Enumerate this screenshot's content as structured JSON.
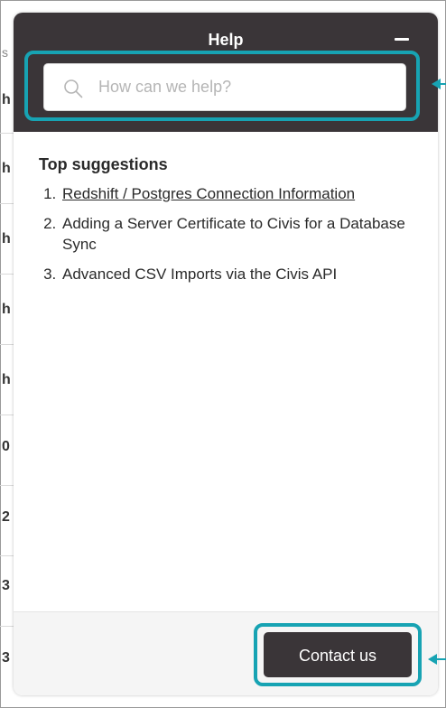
{
  "background": {
    "header_letter": "s",
    "row_letters": [
      "h",
      "h",
      "h",
      "h",
      "h",
      "0",
      "2",
      "3",
      "3"
    ]
  },
  "widget": {
    "title": "Help",
    "search": {
      "placeholder": "How can we help?",
      "value": ""
    },
    "suggestions_title": "Top suggestions",
    "suggestions": [
      {
        "label": "Redshift / Postgres Connection Information",
        "link": true
      },
      {
        "label": "Adding a Server Certificate to Civis for a Database Sync",
        "link": false
      },
      {
        "label": "Advanced CSV Imports via the Civis API",
        "link": false
      }
    ],
    "contact_label": "Contact us"
  },
  "colors": {
    "header_bg": "#3a3538",
    "highlight": "#17a3b3",
    "button_bg": "#3a3538"
  },
  "icons": [
    "search-icon",
    "minimize-icon"
  ]
}
